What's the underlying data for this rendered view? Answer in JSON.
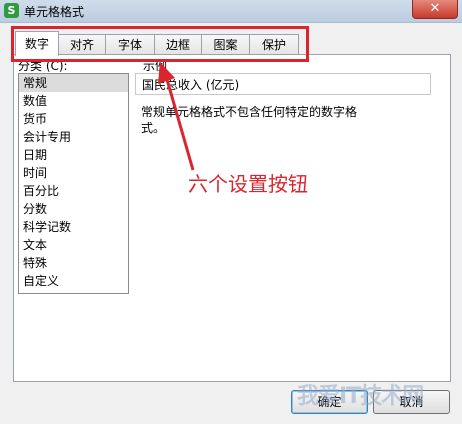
{
  "window": {
    "title": "单元格格式",
    "app_icon": "S",
    "close_glyph": "✕"
  },
  "tabs": [
    {
      "label": "数字",
      "active": true
    },
    {
      "label": "对齐"
    },
    {
      "label": "字体"
    },
    {
      "label": "边框"
    },
    {
      "label": "图案"
    },
    {
      "label": "保护"
    }
  ],
  "category": {
    "label": "分类 (C):",
    "items": [
      "常规",
      "数值",
      "货币",
      "会计专用",
      "日期",
      "时间",
      "百分比",
      "分数",
      "科学记数",
      "文本",
      "特殊",
      "自定义"
    ],
    "selected_index": 0
  },
  "sample": {
    "label": "示例",
    "value": "国民总收入 (亿元)"
  },
  "description": "常规单元格格式不包含任何特定的数字格式。",
  "annotation": "六个设置按钮",
  "buttons": {
    "ok": "确定",
    "cancel": "取消"
  },
  "watermark": "我爱IT技术网",
  "colors": {
    "annotation": "#d9262e",
    "titlebar": "#c4d4e6",
    "close": "#c7392c"
  }
}
